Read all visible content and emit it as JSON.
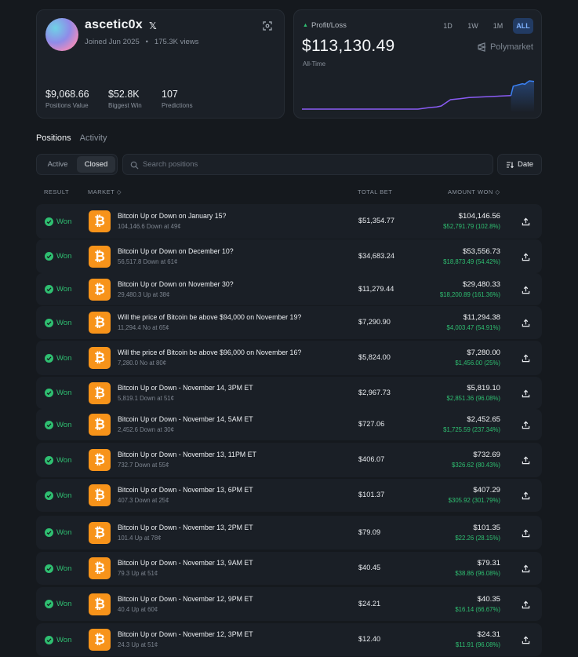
{
  "profile": {
    "name": "ascetic0x",
    "x_badge": "𝕏",
    "joined": "Joined Jun 2025",
    "views": "175.3K views",
    "stats": [
      {
        "value": "$9,068.66",
        "label": "Positions Value"
      },
      {
        "value": "$52.8K",
        "label": "Biggest Win"
      },
      {
        "value": "107",
        "label": "Predictions"
      }
    ]
  },
  "pnl": {
    "label": "Profit/Loss",
    "value": "$113,130.49",
    "period": "All-Time",
    "ranges": [
      "1D",
      "1W",
      "1M",
      "ALL"
    ],
    "active_range": "ALL",
    "brand": "Polymarket",
    "chart": {
      "points": [
        [
          0,
          0.05
        ],
        [
          0.5,
          0.05
        ],
        [
          0.55,
          0.1
        ],
        [
          0.58,
          0.12
        ],
        [
          0.6,
          0.15
        ],
        [
          0.62,
          0.25
        ],
        [
          0.64,
          0.35
        ],
        [
          0.68,
          0.38
        ],
        [
          0.72,
          0.42
        ],
        [
          0.9,
          0.48
        ],
        [
          0.91,
          0.78
        ],
        [
          0.93,
          0.82
        ],
        [
          0.95,
          0.86
        ],
        [
          0.96,
          0.84
        ],
        [
          0.97,
          0.9
        ],
        [
          0.98,
          0.95
        ],
        [
          1,
          0.93
        ]
      ],
      "line_before_color": "#8b5cf6",
      "line_after_color": "#3b82f6"
    }
  },
  "tabs": [
    {
      "label": "Positions",
      "active": true
    },
    {
      "label": "Activity",
      "active": false
    }
  ],
  "filters": [
    {
      "label": "Active",
      "active": false
    },
    {
      "label": "Closed",
      "active": true
    }
  ],
  "search": {
    "placeholder": "Search positions",
    "value": ""
  },
  "sort": {
    "label": "Date"
  },
  "table": {
    "headers": {
      "result": "RESULT",
      "market": "MARKET",
      "total_bet": "TOTAL BET",
      "amount_won": "AMOUNT WON"
    },
    "rows": [
      {
        "result": "Won",
        "title": "Bitcoin Up or Down on January 15?",
        "sub": "104,146.6 Down at 49¢",
        "bet": "$51,354.77",
        "won": "$104,146.56",
        "gain": "$52,791.79 (102.8%)"
      },
      {
        "result": "Won",
        "title": "Bitcoin Up or Down on December 10?",
        "sub": "56,517.8 Down at 61¢",
        "bet": "$34,683.24",
        "won": "$53,556.73",
        "gain": "$18,873.49 (54.42%)"
      },
      {
        "result": "Won",
        "title": "Bitcoin Up or Down on November 30?",
        "sub": "29,480.3 Up at 38¢",
        "bet": "$11,279.44",
        "won": "$29,480.33",
        "gain": "$18,200.89 (161.36%)"
      },
      {
        "result": "Won",
        "title": "Will the price of Bitcoin be above $94,000 on November 19?",
        "sub": "11,294.4 No at 65¢",
        "bet": "$7,290.90",
        "won": "$11,294.38",
        "gain": "$4,003.47 (54.91%)"
      },
      {
        "result": "Won",
        "title": "Will the price of Bitcoin be above $96,000 on November 16?",
        "sub": "7,280.0 No at 80¢",
        "bet": "$5,824.00",
        "won": "$7,280.00",
        "gain": "$1,456.00 (25%)"
      },
      {
        "result": "Won",
        "title": "Bitcoin Up or Down - November 14, 3PM ET",
        "sub": "5,819.1 Down at 51¢",
        "bet": "$2,967.73",
        "won": "$5,819.10",
        "gain": "$2,851.36 (96.08%)"
      },
      {
        "result": "Won",
        "title": "Bitcoin Up or Down - November 14, 5AM ET",
        "sub": "2,452.6 Down at 30¢",
        "bet": "$727.06",
        "won": "$2,452.65",
        "gain": "$1,725.59 (237.34%)"
      },
      {
        "result": "Won",
        "title": "Bitcoin Up or Down - November 13, 11PM ET",
        "sub": "732.7 Down at 55¢",
        "bet": "$406.07",
        "won": "$732.69",
        "gain": "$326.62 (80.43%)"
      },
      {
        "result": "Won",
        "title": "Bitcoin Up or Down - November 13, 6PM ET",
        "sub": "407.3 Down at 25¢",
        "bet": "$101.37",
        "won": "$407.29",
        "gain": "$305.92 (301.79%)"
      },
      {
        "result": "Won",
        "title": "Bitcoin Up or Down - November 13, 2PM ET",
        "sub": "101.4 Up at 78¢",
        "bet": "$79.09",
        "won": "$101.35",
        "gain": "$22.26 (28.15%)"
      },
      {
        "result": "Won",
        "title": "Bitcoin Up or Down - November 13, 9AM ET",
        "sub": "79.3 Up at 51¢",
        "bet": "$40.45",
        "won": "$79.31",
        "gain": "$38.86 (96.08%)"
      },
      {
        "result": "Won",
        "title": "Bitcoin Up or Down - November 12, 9PM ET",
        "sub": "40.4 Up at 60¢",
        "bet": "$24.21",
        "won": "$40.35",
        "gain": "$16.14 (66.67%)"
      },
      {
        "result": "Won",
        "title": "Bitcoin Up or Down - November 12, 3PM ET",
        "sub": "24.3 Up at 51¢",
        "bet": "$12.40",
        "won": "$24.31",
        "gain": "$11.91 (96.08%)"
      }
    ]
  },
  "colors": {
    "won": "#2fbf71",
    "bitcoin": "#f7931a",
    "accent": "#7fb2ff"
  }
}
